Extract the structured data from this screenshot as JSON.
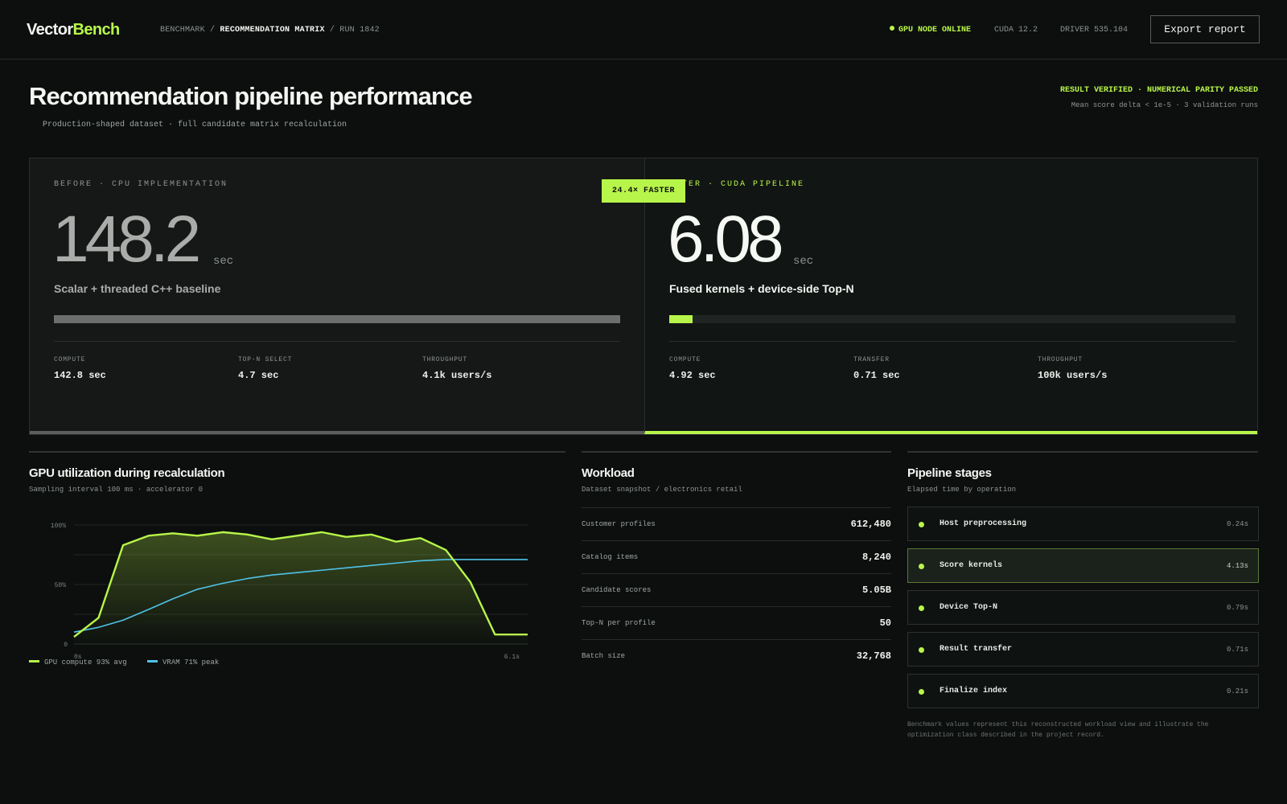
{
  "app": {
    "logo_part1": "Vector",
    "logo_part2": "Bench",
    "breadcrumb": {
      "root": "BENCHMARK",
      "sep1": "/",
      "current": "RECOMMENDATION MATRIX",
      "sep2": "/",
      "run": "RUN 1842"
    },
    "status": {
      "online": "GPU NODE ONLINE",
      "cuda": "CUDA 12.2",
      "driver": "DRIVER 535.104"
    },
    "export_label": "Export report"
  },
  "header": {
    "title": "Recommendation pipeline performance",
    "subtitle": "Production-shaped dataset · full candidate matrix recalculation",
    "verified": "RESULT VERIFIED · NUMERICAL PARITY PASSED",
    "verified_sub": "Mean score delta < 1e-5 · 3 validation runs"
  },
  "comparison": {
    "speedup_badge": "24.4× FASTER",
    "before": {
      "label": "BEFORE · CPU IMPLEMENTATION",
      "value": "148.2",
      "unit": "sec",
      "description": "Scalar + threaded C++ baseline",
      "bar_fraction": 1.0,
      "metrics": [
        {
          "key": "COMPUTE",
          "value": "142.8 sec"
        },
        {
          "key": "TOP-N SELECT",
          "value": "4.7 sec"
        },
        {
          "key": "THROUGHPUT",
          "value": "4.1k users/s"
        }
      ]
    },
    "after": {
      "label": "AFTER · CUDA PIPELINE",
      "value": "6.08",
      "unit": "sec",
      "description": "Fused kernels + device-side Top-N",
      "bar_fraction": 0.041,
      "metrics": [
        {
          "key": "COMPUTE",
          "value": "4.92 sec"
        },
        {
          "key": "TRANSFER",
          "value": "0.71 sec"
        },
        {
          "key": "THROUGHPUT",
          "value": "100k users/s"
        }
      ]
    }
  },
  "gpu_chart": {
    "title": "GPU utilization during recalculation",
    "subtitle": "Sampling interval 100 ms · accelerator 0",
    "legend": [
      "GPU compute 93% avg",
      "VRAM 71% peak"
    ]
  },
  "chart_data": {
    "type": "line",
    "x": [
      0.0,
      0.33,
      0.66,
      1.0,
      1.33,
      1.66,
      2.0,
      2.33,
      2.66,
      3.0,
      3.33,
      3.66,
      4.0,
      4.33,
      4.66,
      5.0,
      5.33,
      5.66,
      6.1
    ],
    "series": [
      {
        "name": "GPU compute 93% avg",
        "color": "#b8f54a",
        "values": [
          6,
          22,
          83,
          91,
          93,
          91,
          94,
          92,
          88,
          91,
          94,
          90,
          92,
          86,
          89,
          79,
          52,
          8,
          8
        ]
      },
      {
        "name": "VRAM 71% peak",
        "color": "#4fc3e8",
        "values": [
          10,
          14,
          20,
          29,
          38,
          46,
          51,
          55,
          58,
          60,
          62,
          64,
          66,
          68,
          70,
          71,
          71,
          71,
          71
        ]
      }
    ],
    "xlabel": "",
    "ylabel": "",
    "y_ticks": [
      "100%",
      "50%",
      "0"
    ],
    "x_ticks": [
      "0s",
      "6.1s"
    ],
    "ylim": [
      0,
      100
    ],
    "xlim": [
      0,
      6.1
    ],
    "grid": true,
    "legend_position": "bottom-left"
  },
  "workload": {
    "title": "Workload",
    "subtitle": "Dataset snapshot / electronics retail",
    "rows": [
      {
        "key": "Customer profiles",
        "value": "612,480"
      },
      {
        "key": "Catalog items",
        "value": "8,240"
      },
      {
        "key": "Candidate scores",
        "value": "5.05B"
      },
      {
        "key": "Top-N per profile",
        "value": "50"
      },
      {
        "key": "Batch size",
        "value": "32,768"
      }
    ]
  },
  "pipeline": {
    "title": "Pipeline stages",
    "subtitle": "Elapsed time by operation",
    "stages": [
      {
        "name": "Host preprocessing",
        "time": "0.24s",
        "active": false
      },
      {
        "name": "Score kernels",
        "time": "4.13s",
        "active": true
      },
      {
        "name": "Device Top-N",
        "time": "0.79s",
        "active": false
      },
      {
        "name": "Result transfer",
        "time": "0.71s",
        "active": false
      },
      {
        "name": "Finalize index",
        "time": "0.21s",
        "active": false
      }
    ],
    "footnote": "Benchmark values represent this reconstructed workload view and illustrate the optimization class described in the project record."
  }
}
